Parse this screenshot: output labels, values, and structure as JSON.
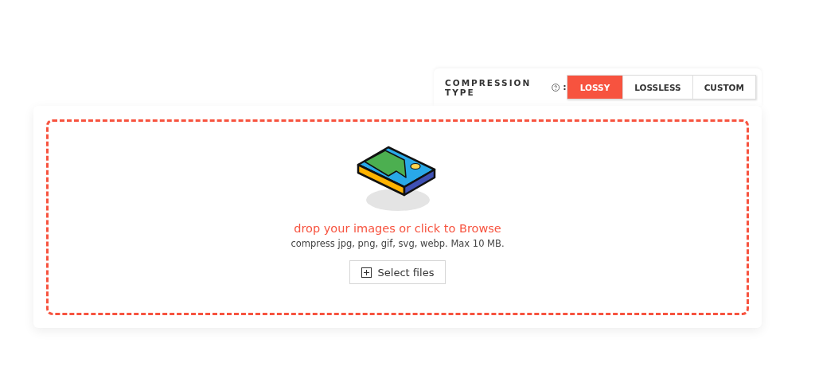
{
  "compression": {
    "label": "COMPRESSION TYPE",
    "separator": ":",
    "options": [
      {
        "label": "LOSSY",
        "selected": true
      },
      {
        "label": "LOSSLESS",
        "selected": false
      },
      {
        "label": "CUSTOM",
        "selected": false
      }
    ]
  },
  "dropzone": {
    "prompt": "drop your images or click to Browse",
    "hint": "compress jpg, png, gif, svg, webp. Max 10 MB.",
    "button": "Select files"
  }
}
